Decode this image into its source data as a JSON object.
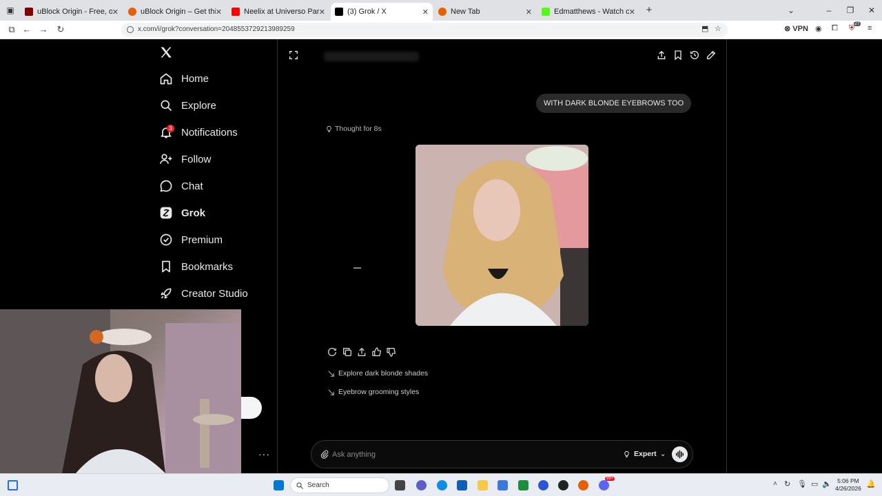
{
  "browser": {
    "tabs": [
      {
        "label": "uBlock Origin - Free, open-sour",
        "color": "#800000"
      },
      {
        "label": "uBlock Origin – Get this Extensi",
        "color": "#e66000"
      },
      {
        "label": "Neelix at Universo Paralello - Yo",
        "color": "#ff0000"
      },
      {
        "label": "(3) Grok / X",
        "color": "#000000"
      },
      {
        "label": "New Tab",
        "color": "#e66000"
      },
      {
        "label": "Edmatthews - Watch clips on Ki",
        "color": "#53fc18"
      }
    ],
    "url": "x.com/i/grok?conversation=2048553729213989259",
    "vpn_label": "VPN",
    "extension_badge": "27"
  },
  "sidebar": {
    "items": [
      {
        "label": "Home",
        "icon": "home-icon"
      },
      {
        "label": "Explore",
        "icon": "search-icon"
      },
      {
        "label": "Notifications",
        "icon": "bell-icon",
        "badge": "3"
      },
      {
        "label": "Follow",
        "icon": "person-add-icon"
      },
      {
        "label": "Chat",
        "icon": "chat-icon"
      },
      {
        "label": "Grok",
        "icon": "grok-icon"
      },
      {
        "label": "Premium",
        "icon": "verified-icon"
      },
      {
        "label": "Bookmarks",
        "icon": "bookmark-icon"
      },
      {
        "label": "Creator Studio",
        "icon": "rocket-icon"
      }
    ],
    "more_label": "···"
  },
  "chat": {
    "user_message": "WITH DARK BLONDE EYEBROWS TOO",
    "thought_label": "Thought for 8s",
    "suggestions": [
      "Explore dark blonde shades",
      "Eyebrow grooming styles"
    ]
  },
  "composer": {
    "placeholder": "Ask anything",
    "mode_label": "Expert"
  },
  "taskbar": {
    "search_label": "Search",
    "time": "5:06 PM",
    "date": "4/26/2026",
    "badge": "99+"
  },
  "colors": {
    "accent": "#1d9bf0",
    "notification_badge": "#f4212e",
    "background": "#000000",
    "text": "#e7e9ea"
  }
}
